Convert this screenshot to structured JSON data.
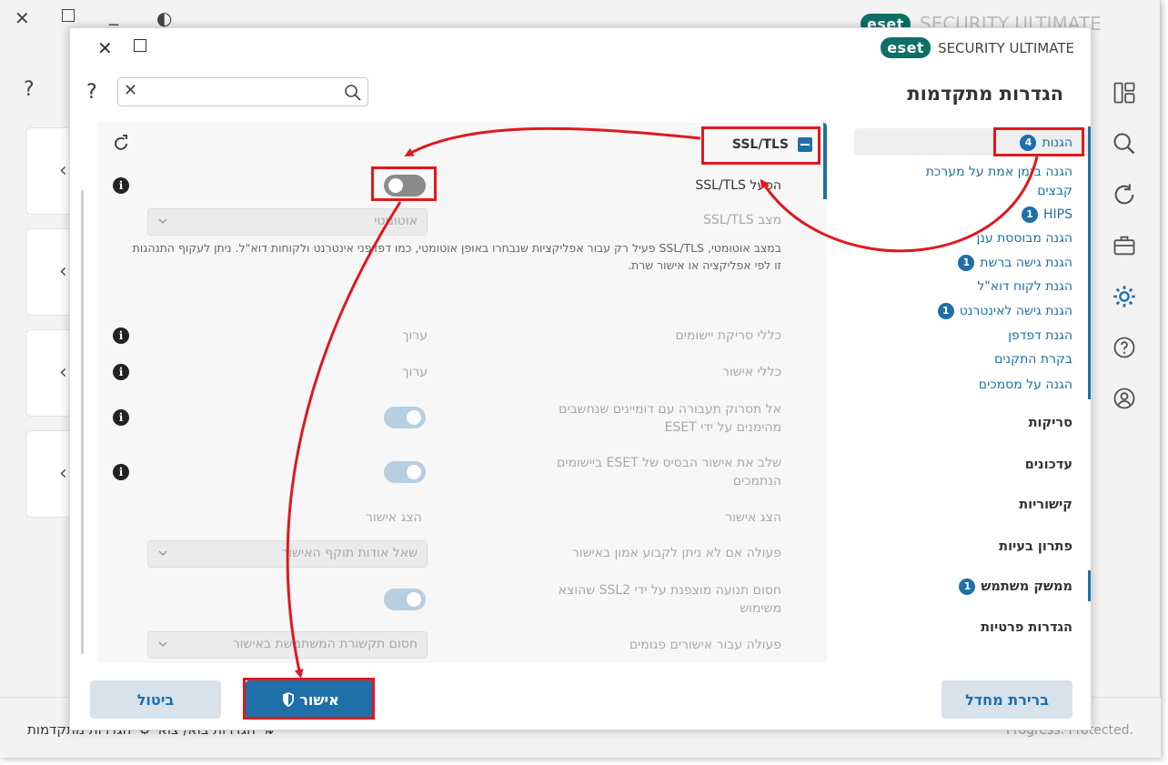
{
  "background_app": {
    "logo_badge": "eset",
    "product_name": "SECURITY ULTIMATE",
    "help_label": "?",
    "footer_left": "הגדרות מתקדמות",
    "footer_mid": "הגדרות בוא/ צוא",
    "footer_right": "Progress. Protected."
  },
  "dialog": {
    "logo_badge": "eset",
    "product_name": "SECURITY ULTIMATE",
    "title": "הגדרות מתקדמות",
    "help_label": "?",
    "search": {
      "value": "",
      "placeholder": ""
    }
  },
  "nav": {
    "section_protection": {
      "label": "הגנות",
      "badge": "4"
    },
    "items": [
      {
        "label": "הגנה בזמן אמת על מערכת קבצים"
      },
      {
        "label": "HIPS",
        "badge": "1"
      },
      {
        "label": "הגנה מבוססת ענן"
      },
      {
        "label": "הגנת גישה ברשת",
        "badge": "1"
      },
      {
        "label": "הגנת לקוח דוא\"ל"
      },
      {
        "label": "הגנת גישה לאינטרנט",
        "badge": "1"
      },
      {
        "label": "הגנת דפדפן"
      },
      {
        "label": "בקרת התקנים"
      },
      {
        "label": "הגנה על מסמכים"
      }
    ],
    "sections": [
      {
        "label": "סריקות"
      },
      {
        "label": "עדכונים"
      },
      {
        "label": "קישוריות"
      },
      {
        "label": "פתרון בעיות"
      },
      {
        "label": "ממשק משתמש",
        "badge": "1"
      },
      {
        "label": "הגדרות פרטיות"
      }
    ]
  },
  "panel": {
    "section_title": "SSL/TLS",
    "enable_label": "הפעל SSL/TLS",
    "enable_state": "off",
    "mode_label": "מצב SSL/TLS",
    "mode_value": "אוטומטי",
    "mode_description": "במצב אוטומטי, SSL/TLS פעיל רק עבור אפליקציות שנבחרו באופן אוטומטי, כמו דפדפני אינטרנט ולקוחות דוא\"ל. ניתן לעקוף התנהגות זו לפי אפליקציה או אישור שרת.",
    "app_rules_label": "כללי סריקת יישומים",
    "app_rules_action": "ערוך",
    "cert_rules_label": "כללי אישור",
    "cert_rules_action": "ערוך",
    "trusted_domains_label": "אל תסרוק תעבורה עם דומיינים שנחשבים מהימנים על ידי ESET",
    "trusted_domains_state": "on",
    "root_cert_label": "שלב את אישור הבסיס של ESET ביישומים הנתמכים",
    "root_cert_state": "on",
    "show_cert_label": "הצג אישור",
    "show_cert_action": "הצג אישור",
    "untrusted_action_label": "פעולה אם לא ניתן לקבוע אמון באישור",
    "untrusted_action_value": "שאל אודות תוקף האישור",
    "block_ssl2_label": "חסום תנועה מוצפנת על ידי SSL2 שהוצא משימוש",
    "block_ssl2_state": "on",
    "damaged_cert_label": "פעולה עבור אישורים פגומים",
    "damaged_cert_value": "חסום תקשורת המשתמשת באישור"
  },
  "buttons": {
    "cancel": "ביטול",
    "ok": "אישור",
    "default": "ברירת מחדל"
  },
  "colors": {
    "accent": "#1f6fa8",
    "annotation": "#e0181e",
    "eset_teal": "#0f6e68"
  }
}
